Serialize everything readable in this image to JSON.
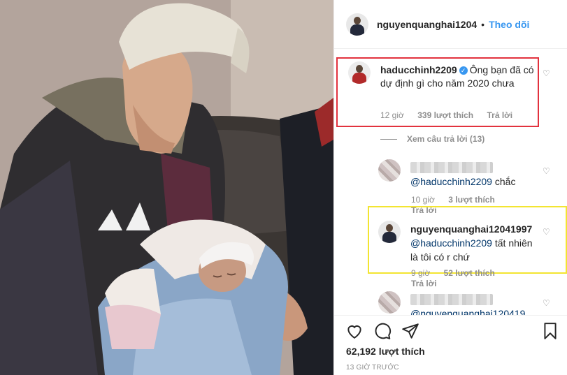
{
  "header": {
    "username": "nguyenquanghai1204",
    "separator": "•",
    "follow_label": "Theo dõi"
  },
  "main_comment": {
    "username": "haducchinh2209",
    "verified_glyph": "✓",
    "text": "Ông bạn đã có dự định gì cho năm 2020 chưa",
    "time": "12 giờ",
    "likes": "339 lượt thích",
    "reply_label": "Trả lời",
    "highlight_color": "#e2323e"
  },
  "view_replies_label": "Xem câu trả lời (13)",
  "replies": [
    {
      "username": "",
      "mention": "@haducchinh2209",
      "text": " chắc",
      "time": "10 giờ",
      "likes": "3 lượt thích",
      "reply_label": "Trả lời"
    },
    {
      "username": "nguyenquanghai12041997",
      "mention": "@haducchinh2209",
      "text": " tất nhiên là tôi có r chứ",
      "time": "9 giờ",
      "likes": "52 lượt thích",
      "reply_label": "Trả lời",
      "highlight_color": "#f3e532"
    },
    {
      "username": "",
      "mention": "@nguyenquanghai120419",
      "text": ""
    }
  ],
  "actions": {
    "like_icon": "heart-icon",
    "comment_icon": "comment-icon",
    "share_icon": "share-icon",
    "save_icon": "bookmark-icon"
  },
  "likes_count": "62,192 lượt thích",
  "timestamp": "13 GIỜ TRƯỚC",
  "colors": {
    "link_blue": "#3897f0",
    "mention": "#003569",
    "muted": "#8e8e8e"
  }
}
